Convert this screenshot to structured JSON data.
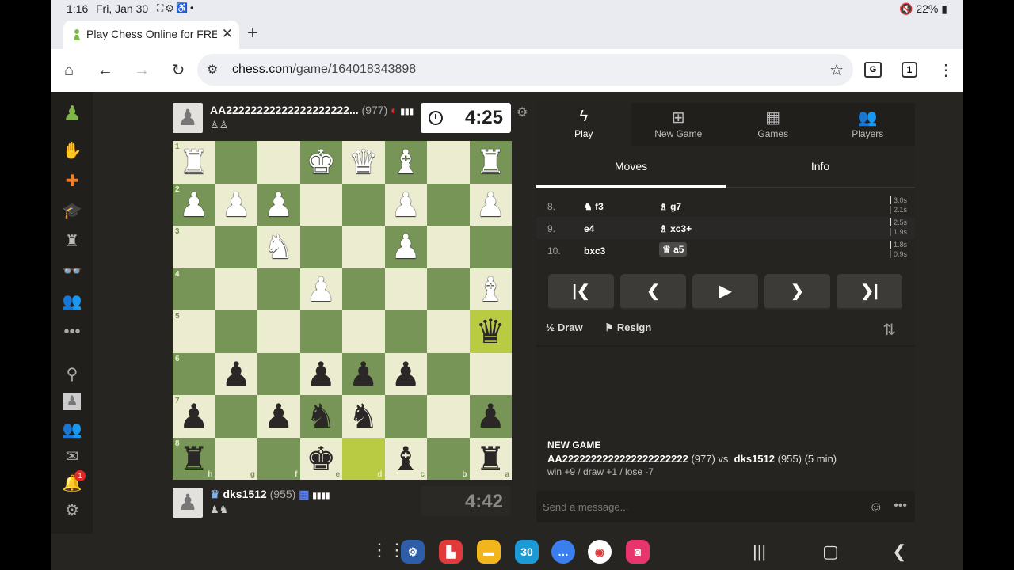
{
  "status_bar": {
    "time": "1:16",
    "date": "Fri, Jan 30",
    "battery": "22%"
  },
  "browser": {
    "tab_title": "Play Chess Online for FREE",
    "url_host": "chess.com",
    "url_path": "/game/164018343898",
    "tab_count": "1"
  },
  "top_player": {
    "name": "AA22222222222222222222...",
    "rating": "(977)",
    "captured": "♙♙",
    "clock": "4:25"
  },
  "bottom_player": {
    "name": "dks1512",
    "rating": "(955)",
    "captured": "♟♞",
    "clock": "4:42"
  },
  "board": {
    "rank_labels": [
      "1",
      "2",
      "3",
      "4",
      "5",
      "6",
      "7",
      "8"
    ],
    "file_labels": [
      "h",
      "g",
      "f",
      "e",
      "d",
      "c",
      "b",
      "a"
    ]
  },
  "panel": {
    "tabs": [
      {
        "label": "Play",
        "icon": "lightning-icon"
      },
      {
        "label": "New Game",
        "icon": "plus-icon"
      },
      {
        "label": "Games",
        "icon": "board-icon"
      },
      {
        "label": "Players",
        "icon": "players-icon"
      }
    ],
    "subtabs": [
      "Moves",
      "Info"
    ],
    "moves": [
      {
        "num": "8.",
        "white": "♞ f3",
        "black": "♗ g7",
        "t1": "3.0s",
        "t2": "2.1s"
      },
      {
        "num": "9.",
        "white": "e4",
        "black": "♗ xc3+",
        "t1": "2.5s",
        "t2": "1.9s"
      },
      {
        "num": "10.",
        "white": "bxc3",
        "black": "♕ a5",
        "t1": "1.8s",
        "t2": "0.9s"
      }
    ],
    "draw_label": "Draw",
    "resign_label": "Resign",
    "chat": {
      "header": "NEW GAME",
      "p1": "AA2222222222222222222222",
      "p1_rating": "(977) vs.",
      "p2": "dks1512",
      "p2_info": "(955) (5 min)",
      "stakes": "win +9 / draw +1 / lose -7"
    },
    "message_placeholder": "Send a message..."
  },
  "dock": {
    "calendar_day": "30"
  },
  "notification_count": "1"
}
